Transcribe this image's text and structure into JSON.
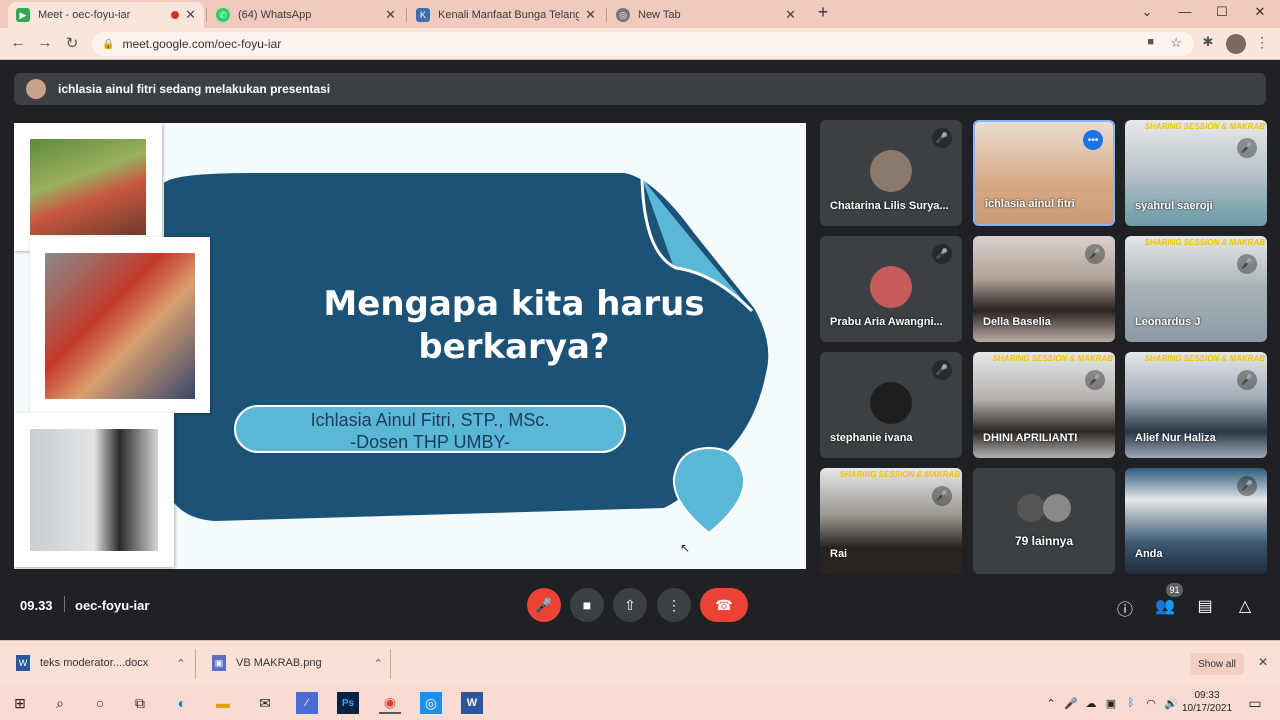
{
  "browser": {
    "tabs": [
      {
        "title": "Meet - oec-foyu-iar",
        "active": true
      },
      {
        "title": "(64) WhatsApp",
        "active": false
      },
      {
        "title": "Kenali Manfaat Bunga Telang Ber",
        "active": false
      },
      {
        "title": "New Tab",
        "active": false
      }
    ],
    "url": "meet.google.com/oec-foyu-iar"
  },
  "meet": {
    "presenting_banner": "ichlasia ainul fitri sedang melakukan presentasi",
    "slide": {
      "title_line1": "Mengapa kita harus",
      "title_line2": "berkarya?",
      "subtitle_line1": "Ichlasia Ainul Fitri, STP., MSc.",
      "subtitle_line2": "-Dosen THP UMBY-"
    },
    "participants": [
      {
        "name": "Chatarina Lilis Surya...",
        "muted": true,
        "kind": "avatar",
        "avatar_color": "#8a7a6c"
      },
      {
        "name": "ichlasia ainul fitri",
        "muted": false,
        "kind": "video",
        "speaking": true,
        "avatar_color": "#d7a48a"
      },
      {
        "name": "syahrul saeroji",
        "muted": true,
        "kind": "video",
        "avatar_color": "#6a9aa6"
      },
      {
        "name": "Prabu Aria Awangni...",
        "muted": true,
        "kind": "avatar",
        "avatar_color": "#c55b5b"
      },
      {
        "name": "Della Baselia",
        "muted": true,
        "kind": "video",
        "avatar_color": "#cfc6c0"
      },
      {
        "name": "Leonardus J",
        "muted": true,
        "kind": "video",
        "avatar_color": "#8d9aa5"
      },
      {
        "name": "stephanie ivana",
        "muted": true,
        "kind": "avatar",
        "avatar_color": "#1e1e1e"
      },
      {
        "name": "DHINI APRILIANTI",
        "muted": true,
        "kind": "video",
        "avatar_color": "#b3b0ad"
      },
      {
        "name": "Alief Nur Haliza",
        "muted": true,
        "kind": "video",
        "avatar_color": "#9eaab6"
      },
      {
        "name": "Rai",
        "muted": true,
        "kind": "video",
        "avatar_color": "#9a968f"
      },
      {
        "name": "79 lainnya",
        "muted": false,
        "kind": "more"
      },
      {
        "name": "Anda",
        "muted": true,
        "kind": "video",
        "avatar_color": "#3e5a73"
      }
    ],
    "bg_banner_text": "SHARING SESSION & MAKRAB",
    "time": "09.33",
    "meeting_code": "oec-foyu-iar",
    "participants_count": "91"
  },
  "downloads": {
    "items": [
      "teks moderator....docx",
      "VB MAKRAB.png"
    ],
    "show_all": "Show all"
  },
  "taskbar": {
    "time": "09:33",
    "date": "10/17/2021"
  },
  "colors": {
    "meet_bg": "#202124",
    "end_call": "#ea4335",
    "slide_blob": "#1d5277",
    "slide_accent": "#5bb7d6",
    "browser_chrome": "#fae5dd"
  }
}
